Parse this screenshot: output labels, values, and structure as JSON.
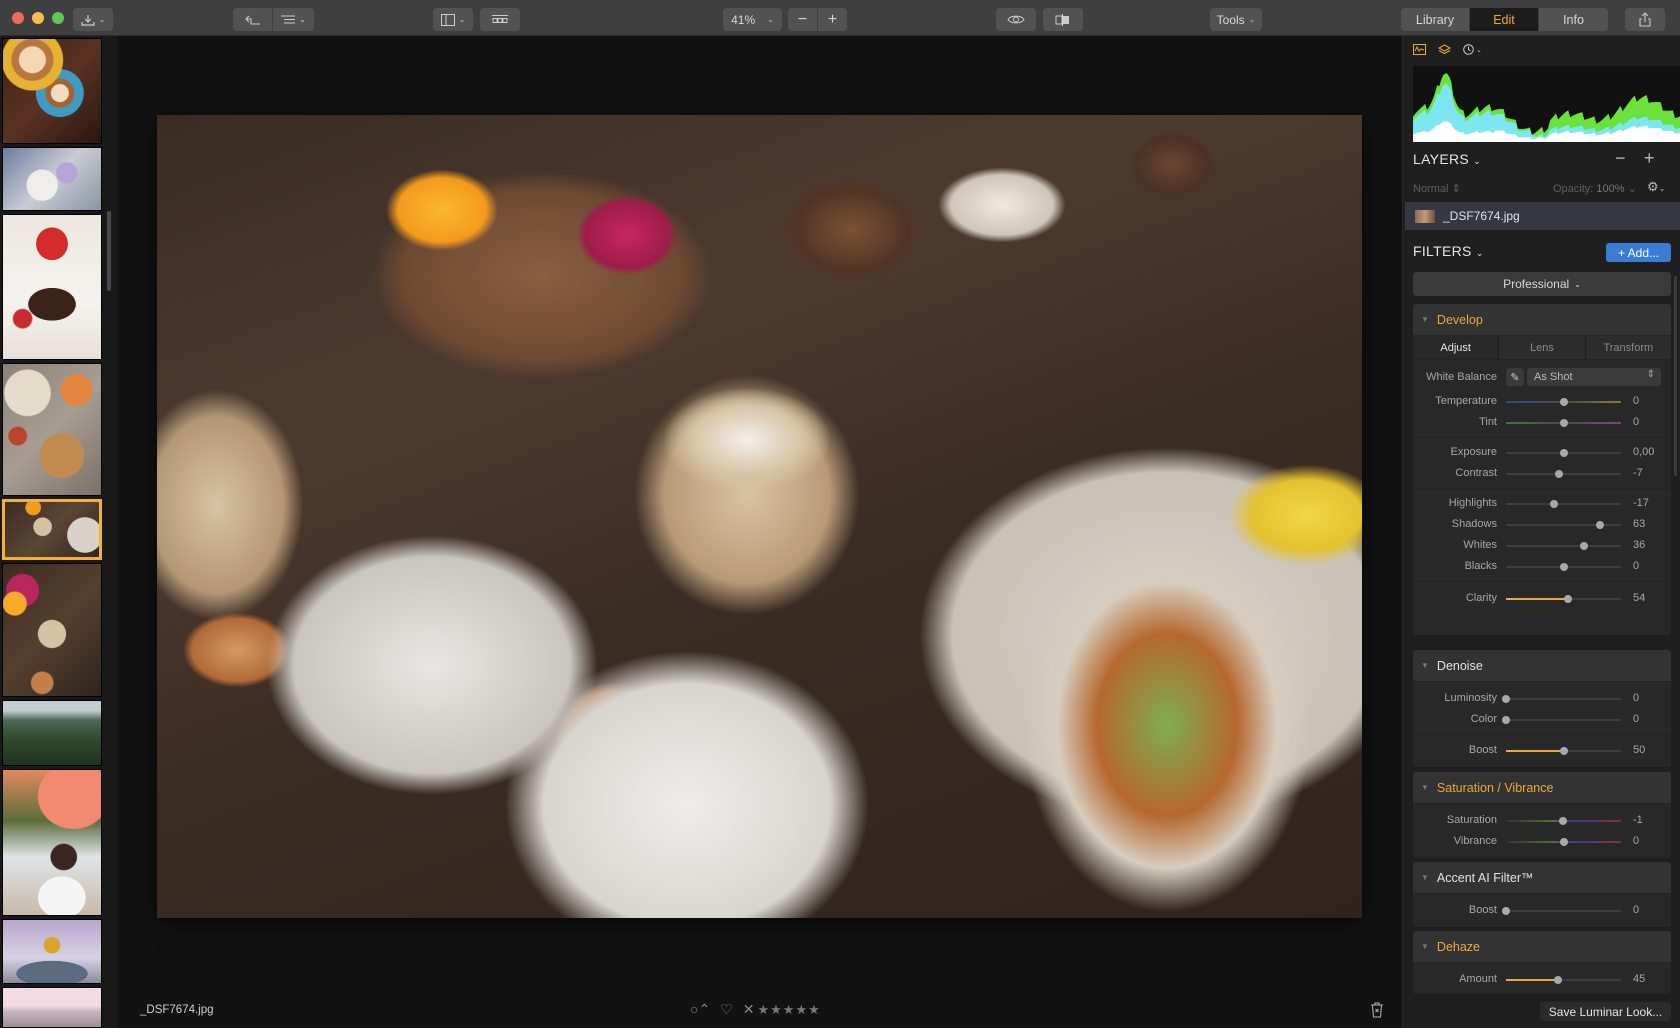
{
  "toolbar": {
    "zoom_value": "41%",
    "tools_label": "Tools",
    "modes": [
      {
        "label": "Library",
        "active": false
      },
      {
        "label": "Edit",
        "active": true
      },
      {
        "label": "Info",
        "active": false
      }
    ],
    "icons": [
      "import-icon",
      "undo-icon",
      "list-view-icon",
      "sidebar-toggle-icon",
      "filmstrip-icon",
      "zoom-out-icon",
      "zoom-in-icon",
      "preview-eye-icon",
      "compare-icon",
      "share-icon"
    ]
  },
  "filmstrip": {
    "thumbnails": [
      {
        "subject": "lattes on yellow and blue saucers",
        "selected": false
      },
      {
        "subject": "smoothie and berries",
        "selected": false
      },
      {
        "subject": "brownie with strawberries",
        "selected": false
      },
      {
        "subject": "salads and plates top-down",
        "selected": false
      },
      {
        "subject": "breakfast table with latte",
        "selected": true
      },
      {
        "subject": "latte close-up with fruit bowl",
        "selected": false
      },
      {
        "subject": "coastal cliff",
        "selected": false
      },
      {
        "subject": "woman with sunglasses under blossoms",
        "selected": false
      },
      {
        "subject": "person in yellow hat under tree",
        "selected": false
      },
      {
        "subject": "city skyline pink",
        "selected": false
      }
    ]
  },
  "bottombar": {
    "filename": "_DSF7674.jpg",
    "rating_stars": "★★★★★",
    "reject_symbol": "✕",
    "flag_symbol": "♡",
    "label_symbol": "○⌃"
  },
  "panel": {
    "layers_title": "LAYERS",
    "blend_mode": "Normal",
    "opacity_label": "Opacity:",
    "opacity_value": "100%",
    "layer_name": "_DSF7674.jpg",
    "filters_title": "FILTERS",
    "add_label": "+ Add...",
    "preset": "Professional",
    "save_look_label": "Save Luminar Look...",
    "develop": {
      "title": "Develop",
      "tabs": [
        {
          "label": "Adjust",
          "active": true
        },
        {
          "label": "Lens",
          "active": false
        },
        {
          "label": "Transform",
          "active": false
        }
      ],
      "white_balance_label": "White Balance",
      "white_balance_value": "As Shot",
      "temperature": {
        "label": "Temperature",
        "value": "0",
        "pos": 0.5
      },
      "tint": {
        "label": "Tint",
        "value": "0",
        "pos": 0.5
      },
      "exposure": {
        "label": "Exposure",
        "value": "0,00",
        "pos": 0.5
      },
      "contrast": {
        "label": "Contrast",
        "value": "-7",
        "pos": 0.465
      },
      "highlights": {
        "label": "Highlights",
        "value": "-17",
        "pos": 0.415
      },
      "shadows": {
        "label": "Shadows",
        "value": "63",
        "pos": 0.815
      },
      "whites": {
        "label": "Whites",
        "value": "36",
        "pos": 0.68
      },
      "blacks": {
        "label": "Blacks",
        "value": "0",
        "pos": 0.5
      },
      "clarity": {
        "label": "Clarity",
        "value": "54",
        "pos": 0.54
      }
    },
    "denoise": {
      "title": "Denoise",
      "luminosity": {
        "label": "Luminosity",
        "value": "0",
        "pos": 0.0
      },
      "color": {
        "label": "Color",
        "value": "0",
        "pos": 0.0
      },
      "boost": {
        "label": "Boost",
        "value": "50",
        "pos": 0.5
      }
    },
    "satvib": {
      "title": "Saturation / Vibrance",
      "saturation": {
        "label": "Saturation",
        "value": "-1",
        "pos": 0.495
      },
      "vibrance": {
        "label": "Vibrance",
        "value": "0",
        "pos": 0.5
      }
    },
    "accent": {
      "title": "Accent AI Filter™",
      "boost": {
        "label": "Boost",
        "value": "0",
        "pos": 0.0
      }
    },
    "dehaze": {
      "title": "Dehaze",
      "amount": {
        "label": "Amount",
        "value": "45",
        "pos": 0.45
      }
    }
  },
  "colors": {
    "accent": "#e8a93d",
    "add_button": "#3b7bd5",
    "selected_thumb": "#f0b23a"
  }
}
